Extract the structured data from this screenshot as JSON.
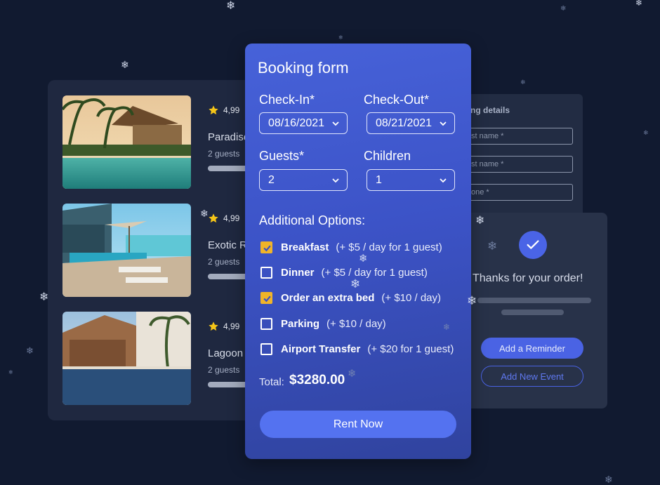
{
  "listings": [
    {
      "rating": "4,99",
      "name": "Paradise",
      "guests": "2 guests"
    },
    {
      "rating": "4,99",
      "name": "Exotic R",
      "guests": "2 guests"
    },
    {
      "rating": "4,99",
      "name": "Lagoon",
      "guests": "2 guests"
    }
  ],
  "details_panel": {
    "title": "ng details",
    "fields": [
      "st name *",
      "st name *",
      "one *"
    ]
  },
  "confirmation": {
    "title": "Thanks for your order!",
    "reminder_button": "Add a Reminder",
    "new_event_button": "Add New Event"
  },
  "booking_form": {
    "title": "Booking form",
    "checkin_label": "Check-In*",
    "checkin_value": "08/16/2021",
    "checkout_label": "Check-Out*",
    "checkout_value": "08/21/2021",
    "guests_label": "Guests*",
    "guests_value": "2",
    "children_label": "Children",
    "children_value": "1",
    "options_heading": "Additional Options:",
    "options": [
      {
        "name": "Breakfast",
        "price": "(+ $5 / day for 1 guest)",
        "checked": true
      },
      {
        "name": "Dinner",
        "price": "(+ $5 / day for 1 guest)",
        "checked": false
      },
      {
        "name": "Order an extra bed",
        "price": "(+ $10 / day)",
        "checked": true
      },
      {
        "name": "Parking",
        "price": "(+ $10 / day)",
        "checked": false
      },
      {
        "name": "Airport Transfer",
        "price": "(+ $20 for 1 guest)",
        "checked": false
      }
    ],
    "total_label": "Total:",
    "total_value": "$3280.00",
    "submit_label": "Rent Now"
  },
  "colors": {
    "background": "#111a30",
    "form_accent": "#4762d9",
    "button": "#5472f0",
    "checkbox_checked": "#f0b429",
    "star": "#f5c518"
  },
  "icons": [
    "star-icon",
    "chevron-down-icon",
    "checkmark-icon",
    "snowflake-icon"
  ]
}
